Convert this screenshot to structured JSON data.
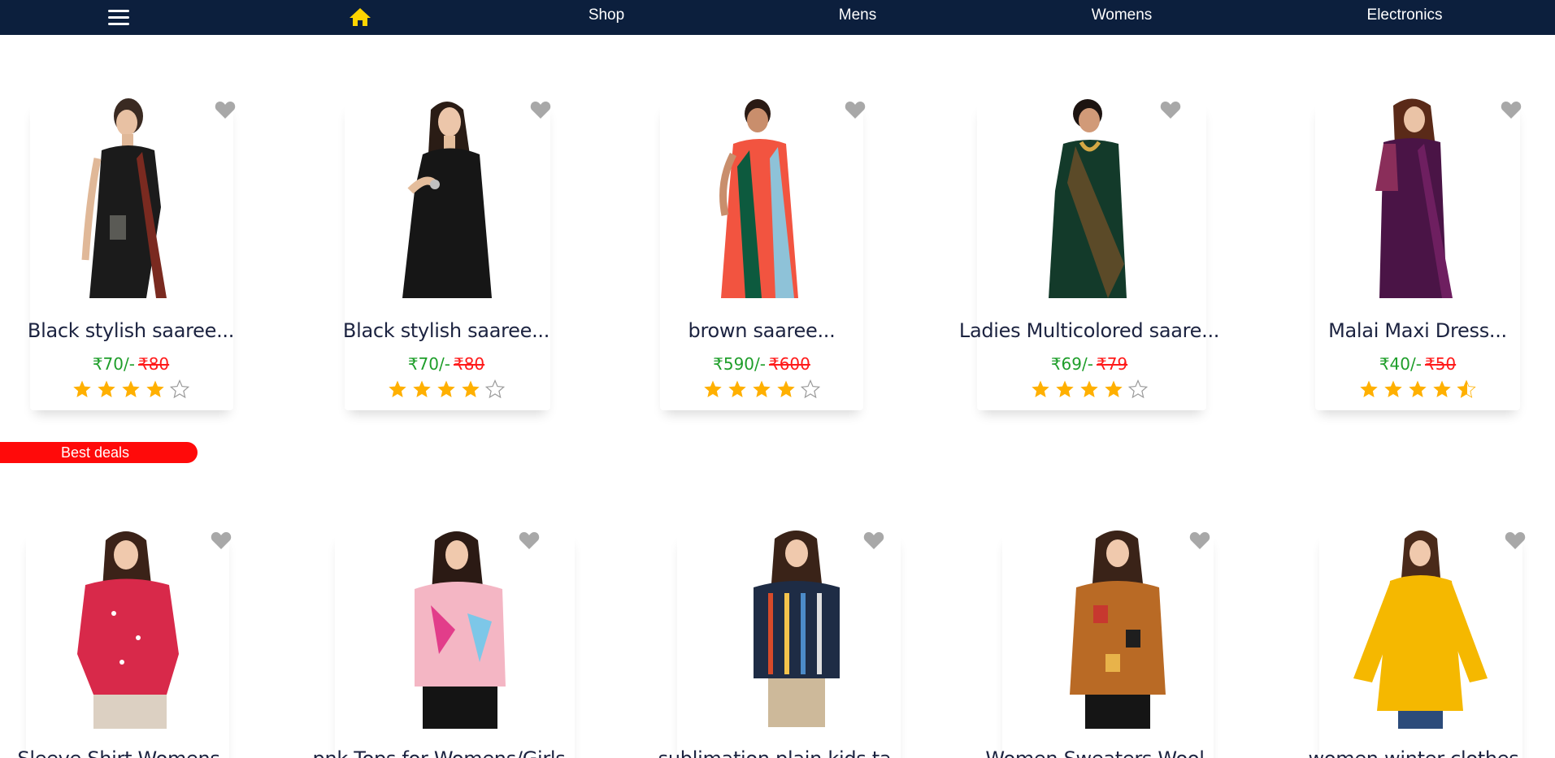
{
  "nav": {
    "links": [
      "Shop",
      "Mens",
      "Womens",
      "Electronics"
    ],
    "bg_color": "#0c1f3d",
    "home_icon_color": "#ffd400"
  },
  "colors": {
    "price_new": "#1e9e2a",
    "price_old": "#ff1a1a",
    "star": "#ffb000",
    "banner": "#ff0a0a"
  },
  "section1": {
    "products": [
      {
        "title": "Black stylish saaree...",
        "price": "₹70/-",
        "old_price": "₹80",
        "rating": 4
      },
      {
        "title": "Black stylish saaree...",
        "price": "₹70/-",
        "old_price": "₹80",
        "rating": 4
      },
      {
        "title": "brown saaree...",
        "price": "₹590/-",
        "old_price": "₹600",
        "rating": 4
      },
      {
        "title": "Ladies Multicolored saare...",
        "price": "₹69/-",
        "old_price": "₹79",
        "rating": 4
      },
      {
        "title": "Malai Maxi Dress...",
        "price": "₹40/-",
        "old_price": "₹50",
        "rating": 4.5
      }
    ]
  },
  "best_deals": {
    "label": "Best deals"
  },
  "section2": {
    "products": [
      {
        "title": "Sleeve Shirt Womens..."
      },
      {
        "title": "pnk Tops for Womens/Girls..."
      },
      {
        "title": "sublimation plain kids ta..."
      },
      {
        "title": "Women Sweaters Wool..."
      },
      {
        "title": "women winter clothes..."
      }
    ]
  }
}
